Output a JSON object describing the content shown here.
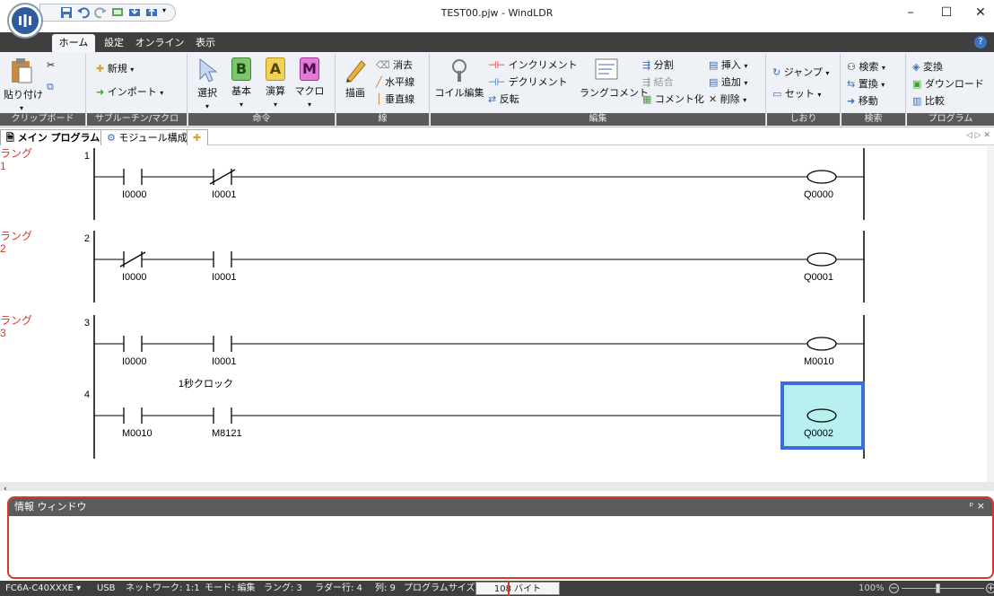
{
  "window": {
    "title": "TEST00.pjw - WindLDR",
    "minimize": "–",
    "maximize": "☐",
    "close": "✕"
  },
  "tabs": [
    "ホーム",
    "設定",
    "オンライン",
    "表示"
  ],
  "groups": {
    "clipboard": "クリップボード",
    "subroutine": "サブルーチン/マクロ",
    "instruction": "命令",
    "line": "線",
    "edit": "編集",
    "bookmark": "しおり",
    "search": "検索",
    "program": "プログラム"
  },
  "ribbon": {
    "paste": "貼り付け",
    "new": "新規",
    "import": "インポート",
    "select": "選択",
    "basic": "基本",
    "advanced": "演算",
    "macro": "マクロ",
    "draw": "描画",
    "erase": "消去",
    "hline": "水平線",
    "vline": "垂直線",
    "coil_edit": "コイル編集",
    "increment": "インクリメント",
    "decrement": "デクリメント",
    "invert": "反転",
    "rung_comment": "ラングコメント",
    "split": "分割",
    "merge": "結合",
    "comment_out": "コメント化",
    "insert": "挿入",
    "append": "追加",
    "delete": "削除",
    "jump": "ジャンプ",
    "set": "セット",
    "find": "検索",
    "replace": "置換",
    "move": "移動",
    "convert": "変換",
    "download": "ダウンロード",
    "compare": "比較",
    "basic_letter": "B",
    "advanced_letter": "A",
    "macro_letter": "M"
  },
  "doc_tabs": [
    "メイン プログラム",
    "モジュール構成"
  ],
  "ladder": {
    "rung_label": "ラング",
    "rungs": [
      {
        "num": "1",
        "line": "1",
        "contacts": [
          {
            "addr": "I0000",
            "type": "NO"
          },
          {
            "addr": "I0001",
            "type": "NC"
          }
        ],
        "coil": "Q0000"
      },
      {
        "num": "2",
        "line": "2",
        "contacts": [
          {
            "addr": "I0000",
            "type": "NC"
          },
          {
            "addr": "I0001",
            "type": "NO"
          }
        ],
        "coil": "Q0001"
      },
      {
        "num": "3",
        "line": "3",
        "contacts": [
          {
            "addr": "I0000",
            "type": "NO"
          },
          {
            "addr": "I0001",
            "type": "NO"
          }
        ],
        "coil": "M0010"
      },
      {
        "num": "",
        "line": "4",
        "contacts": [
          {
            "addr": "M0010",
            "type": "NO"
          },
          {
            "addr": "M8121",
            "type": "NO"
          }
        ],
        "coil": "Q0002",
        "comment": "1秒クロック"
      }
    ]
  },
  "info_window": {
    "title": "情報 ウィンドウ",
    "pin": "ᵖ ×"
  },
  "status": {
    "plc": "FC6A-C40XXXE",
    "conn": "USB",
    "network": "ネットワーク: 1:1",
    "mode": "モード: 編集",
    "rung": "ラング: 3",
    "row": "ラダー行: 4",
    "col": "列: 9",
    "size_label": "プログラムサイズ:",
    "size_value": "108 バイト",
    "zoom": "100%"
  },
  "colors": {
    "accent": "#d9362c",
    "selection_fill": "#b8f0f0",
    "selection_border": "#3a6fd8"
  }
}
